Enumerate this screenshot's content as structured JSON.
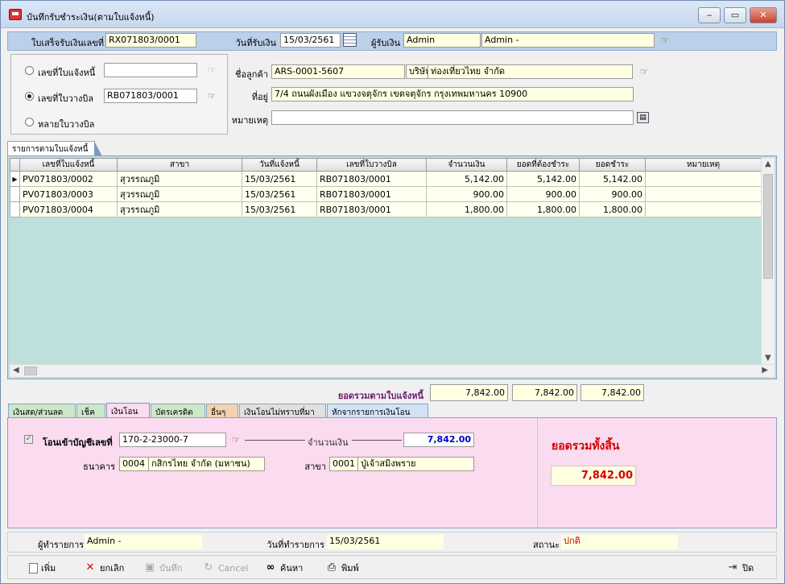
{
  "window": {
    "title": "บันทึกรับชำระเงิน(ตามใบแจ้งหนี้)",
    "min": "‒",
    "max": "▭",
    "close": "✕"
  },
  "header": {
    "receipt_label": "ใบเสร็จรับเงินเลขที่",
    "receipt_no": "RX071803/0001",
    "date_label": "วันที่รับเงิน",
    "date": "15/03/2561",
    "receiver_label": "ผู้รับเงิน",
    "receiver_code": "Admin",
    "receiver_name": "Admin -"
  },
  "selector": {
    "opt1": "เลขที่ใบแจ้งหนี้",
    "opt1_value": "",
    "opt2": "เลขที่ใบวางบิล",
    "opt2_value": "RB071803/0001",
    "opt3": "หลายใบวางบิล"
  },
  "customer": {
    "name_label": "ชื่อลูกค้า",
    "code": "ARS-0001-5607",
    "prefix": "บริษัท",
    "name": "ท่องเที่ยวไทย จำกัด",
    "address_label": "ที่อยู่",
    "address": "7/4 ถนนผังเมือง  แขวงจตุจักร เขตจตุจักร  กรุงเทพมหานคร 10900",
    "note_label": "หมายเหตุ",
    "note": ""
  },
  "grid": {
    "tab": "รายการตามใบแจ้งหนี้",
    "columns": [
      "เลขที่ใบแจ้งหนี้",
      "สาขา",
      "วันที่แจ้งหนี้",
      "เลขที่ใบวางบิล",
      "จำนวนเงิน",
      "ยอดที่ต้องชำระ",
      "ยอดชำระ",
      "หมายเหตุ"
    ],
    "rows": [
      [
        "PV071803/0002",
        "สุวรรณภูมิ",
        "15/03/2561",
        "RB071803/0001",
        "5,142.00",
        "5,142.00",
        "5,142.00",
        ""
      ],
      [
        "PV071803/0003",
        "สุวรรณภูมิ",
        "15/03/2561",
        "RB071803/0001",
        "900.00",
        "900.00",
        "900.00",
        ""
      ],
      [
        "PV071803/0004",
        "สุวรรณภูมิ",
        "15/03/2561",
        "RB071803/0001",
        "1,800.00",
        "1,800.00",
        "1,800.00",
        ""
      ]
    ],
    "total_label": "ยอดรวมตามใบแจ้งหนี้",
    "totals": [
      "7,842.00",
      "7,842.00",
      "7,842.00"
    ]
  },
  "payment_tabs": [
    "เงินสด/ส่วนลด",
    "เช็ค",
    "เงินโอน",
    "บัตรเครดิต",
    "อื่นๆ",
    "เงินโอนไม่ทราบที่มา",
    "หักจากรายการเงินโอน"
  ],
  "transfer": {
    "account_label": "โอนเข้าบัญชีเลขที่",
    "account": "170-2-23000-7",
    "amount_label": "จำนวนเงิน",
    "amount": "7,842.00",
    "bank_label": "ธนาคาร",
    "bank_code": "0004",
    "bank_name": "กสิกรไทย  จำกัด (มหาชน)",
    "branch_label": "สาขา",
    "branch_code": "0001",
    "branch_name": "ปู่เจ้าสมิงพราย"
  },
  "grand_total": {
    "label": "ยอดรวมทั้งสิ้น",
    "value": "7,842.00"
  },
  "status": {
    "operator_label": "ผู้ทำรายการ",
    "operator": "Admin -",
    "date_label": "วันที่ทำรายการ",
    "date": "15/03/2561",
    "state_label": "สถานะ",
    "state": "ปกติ"
  },
  "toolbar": {
    "add": "เพิ่ม",
    "cancel_doc": "ยกเลิก",
    "save": "บันทึก",
    "cancel": "Cancel",
    "search": "ค้นหา",
    "print": "พิมพ์",
    "close": "ปิด"
  },
  "colors": {
    "header_band": "#bcd0ea",
    "field": "#ffffe1",
    "grid_bg": "#bfdfdd",
    "panel": "#fbdbef",
    "total_red": "#d40000",
    "amount_blue": "#0000cc",
    "tab_active": "#ffffff"
  }
}
